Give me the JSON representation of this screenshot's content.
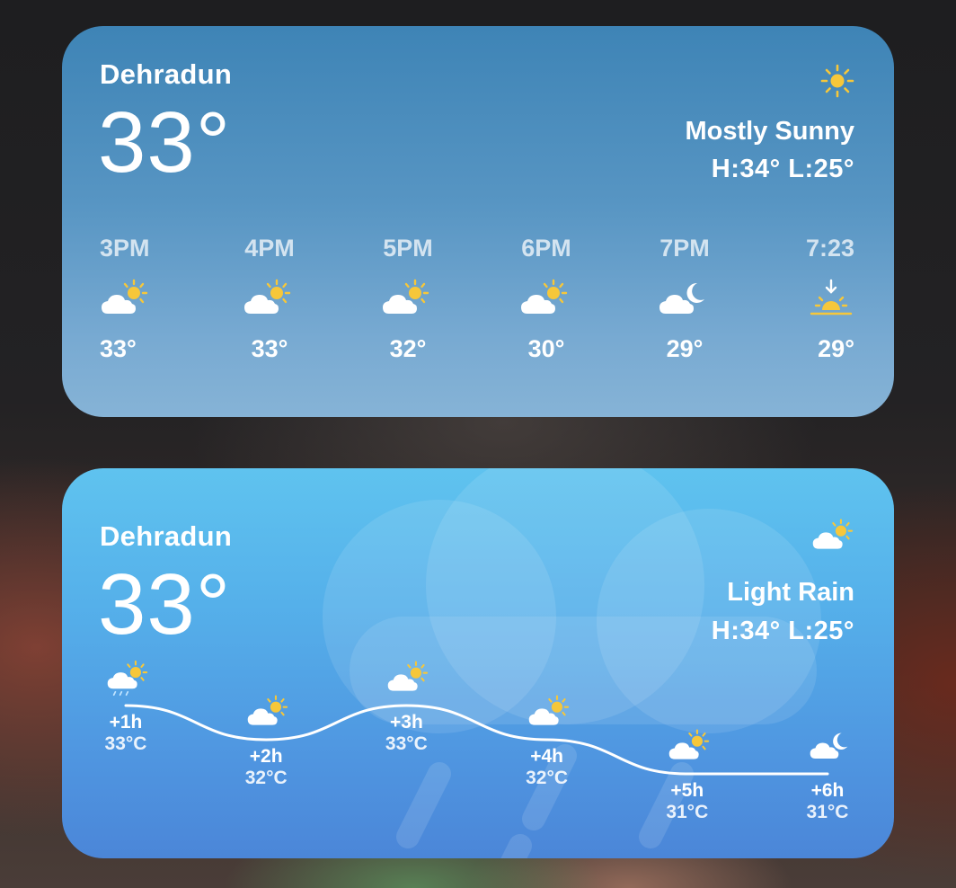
{
  "widget_top": {
    "city": "Dehradun",
    "temperature": "33°",
    "condition": "Mostly Sunny",
    "hi_lo": "H:34° L:25°",
    "condition_icon": "sun-icon",
    "hourly": [
      {
        "time": "3PM",
        "icon": "partly-sunny-icon",
        "temp": "33°"
      },
      {
        "time": "4PM",
        "icon": "partly-sunny-icon",
        "temp": "33°"
      },
      {
        "time": "5PM",
        "icon": "partly-sunny-icon",
        "temp": "32°"
      },
      {
        "time": "6PM",
        "icon": "partly-sunny-icon",
        "temp": "30°"
      },
      {
        "time": "7PM",
        "icon": "partly-cloudy-night-icon",
        "temp": "29°"
      },
      {
        "time": "7:23",
        "icon": "sunset-icon",
        "temp": "29°"
      }
    ]
  },
  "widget_bottom": {
    "city": "Dehradun",
    "temperature": "33°",
    "condition": "Light Rain",
    "hi_lo": "H:34° L:25°",
    "condition_icon": "partly-sunny-icon",
    "forecast": [
      {
        "step": "+1h",
        "temp": "33°C",
        "value": 33,
        "icon": "sun-rain-icon"
      },
      {
        "step": "+2h",
        "temp": "32°C",
        "value": 32,
        "icon": "partly-sunny-icon"
      },
      {
        "step": "+3h",
        "temp": "33°C",
        "value": 33,
        "icon": "partly-sunny-icon"
      },
      {
        "step": "+4h",
        "temp": "32°C",
        "value": 32,
        "icon": "partly-sunny-icon"
      },
      {
        "step": "+5h",
        "temp": "31°C",
        "value": 31,
        "icon": "partly-sunny-icon"
      },
      {
        "step": "+6h",
        "temp": "31°C",
        "value": 31,
        "icon": "partly-cloudy-night-icon"
      }
    ]
  },
  "colors": {
    "sun": "#f6c73a",
    "cloud": "#ffffff",
    "moon": "#ffffff"
  }
}
